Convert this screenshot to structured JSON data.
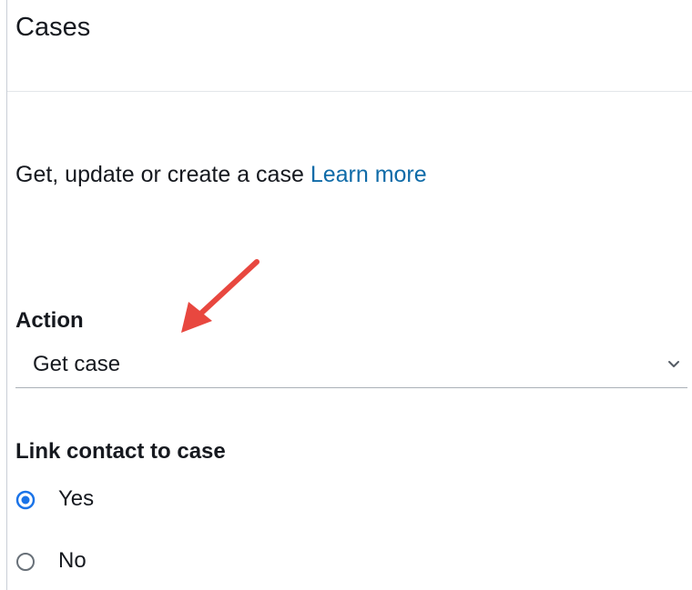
{
  "panel": {
    "title": "Cases",
    "description": "Get, update or create a case",
    "learn_more": "Learn more"
  },
  "action": {
    "label": "Action",
    "selected": "Get case",
    "chevron_icon": "chevron-down-icon"
  },
  "link_contact": {
    "label": "Link contact to case",
    "options": [
      {
        "label": "Yes",
        "selected": true
      },
      {
        "label": "No",
        "selected": false
      }
    ]
  },
  "colors": {
    "link": "#0f6ba8",
    "radio_selected": "#1a73e8",
    "annotation_arrow": "#e8473f"
  }
}
